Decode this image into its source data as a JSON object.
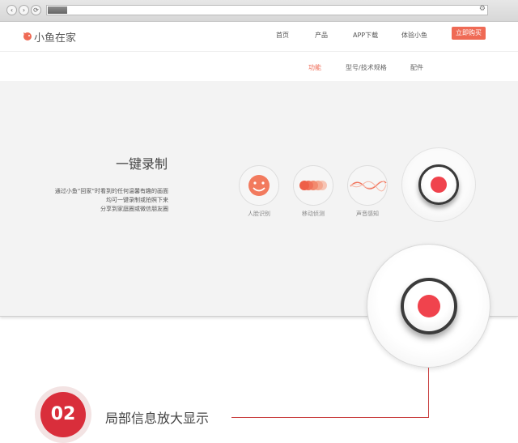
{
  "browser": {
    "back_glyph": "‹",
    "forward_glyph": "›",
    "reload_glyph": "⟳",
    "settings_glyph": "⚙"
  },
  "site": {
    "logo": "小鱼在家",
    "menu": [
      "首页",
      "产品",
      "APP下载",
      "体验小鱼"
    ],
    "buy_label": "立即购买",
    "subnav": [
      "功能",
      "型号/技术规格",
      "配件"
    ],
    "subnav_active": "功能"
  },
  "feature": {
    "title": "一键录制",
    "description": [
      "通过小鱼“回家”时看到的任何温馨有趣的画面",
      "均可一键录制或拍照下来",
      "分享到家庭圈或微信朋友圈"
    ],
    "icons": [
      {
        "icon": "smile-face-icon",
        "label": "人脸识别"
      },
      {
        "icon": "motion-detect-icon",
        "label": "移动侦测"
      },
      {
        "icon": "sound-wave-icon",
        "label": "声音感知"
      }
    ],
    "record_icon": "record-button-icon"
  },
  "callout": {
    "number": "02",
    "caption": "局部信息放大显示"
  },
  "colors": {
    "accent": "#ef6a55",
    "record_red": "#f0434d",
    "badge_red": "#d92e3b"
  }
}
